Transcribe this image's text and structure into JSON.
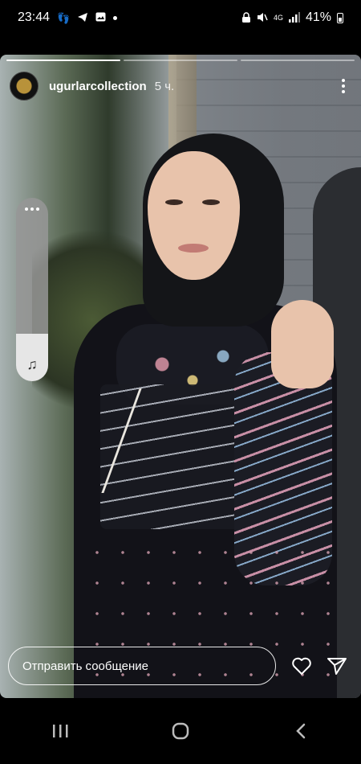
{
  "status_bar": {
    "time": "23:44",
    "network": "4G",
    "battery": "41%",
    "left_icons": [
      "footsteps-icon",
      "telegram-icon",
      "gallery-icon",
      "dot-icon"
    ],
    "right_icons": [
      "lock-icon",
      "mute-icon",
      "signal-icon",
      "battery-icon"
    ]
  },
  "story": {
    "username": "ugurlarcollection",
    "time_ago": "5 ч.",
    "progress_segments": 3,
    "active_segment": 0,
    "volume_level": 0.26
  },
  "reply": {
    "placeholder": "Отправить сообщение"
  },
  "nav": {
    "buttons": [
      "recents-icon",
      "home-icon",
      "back-icon"
    ]
  }
}
